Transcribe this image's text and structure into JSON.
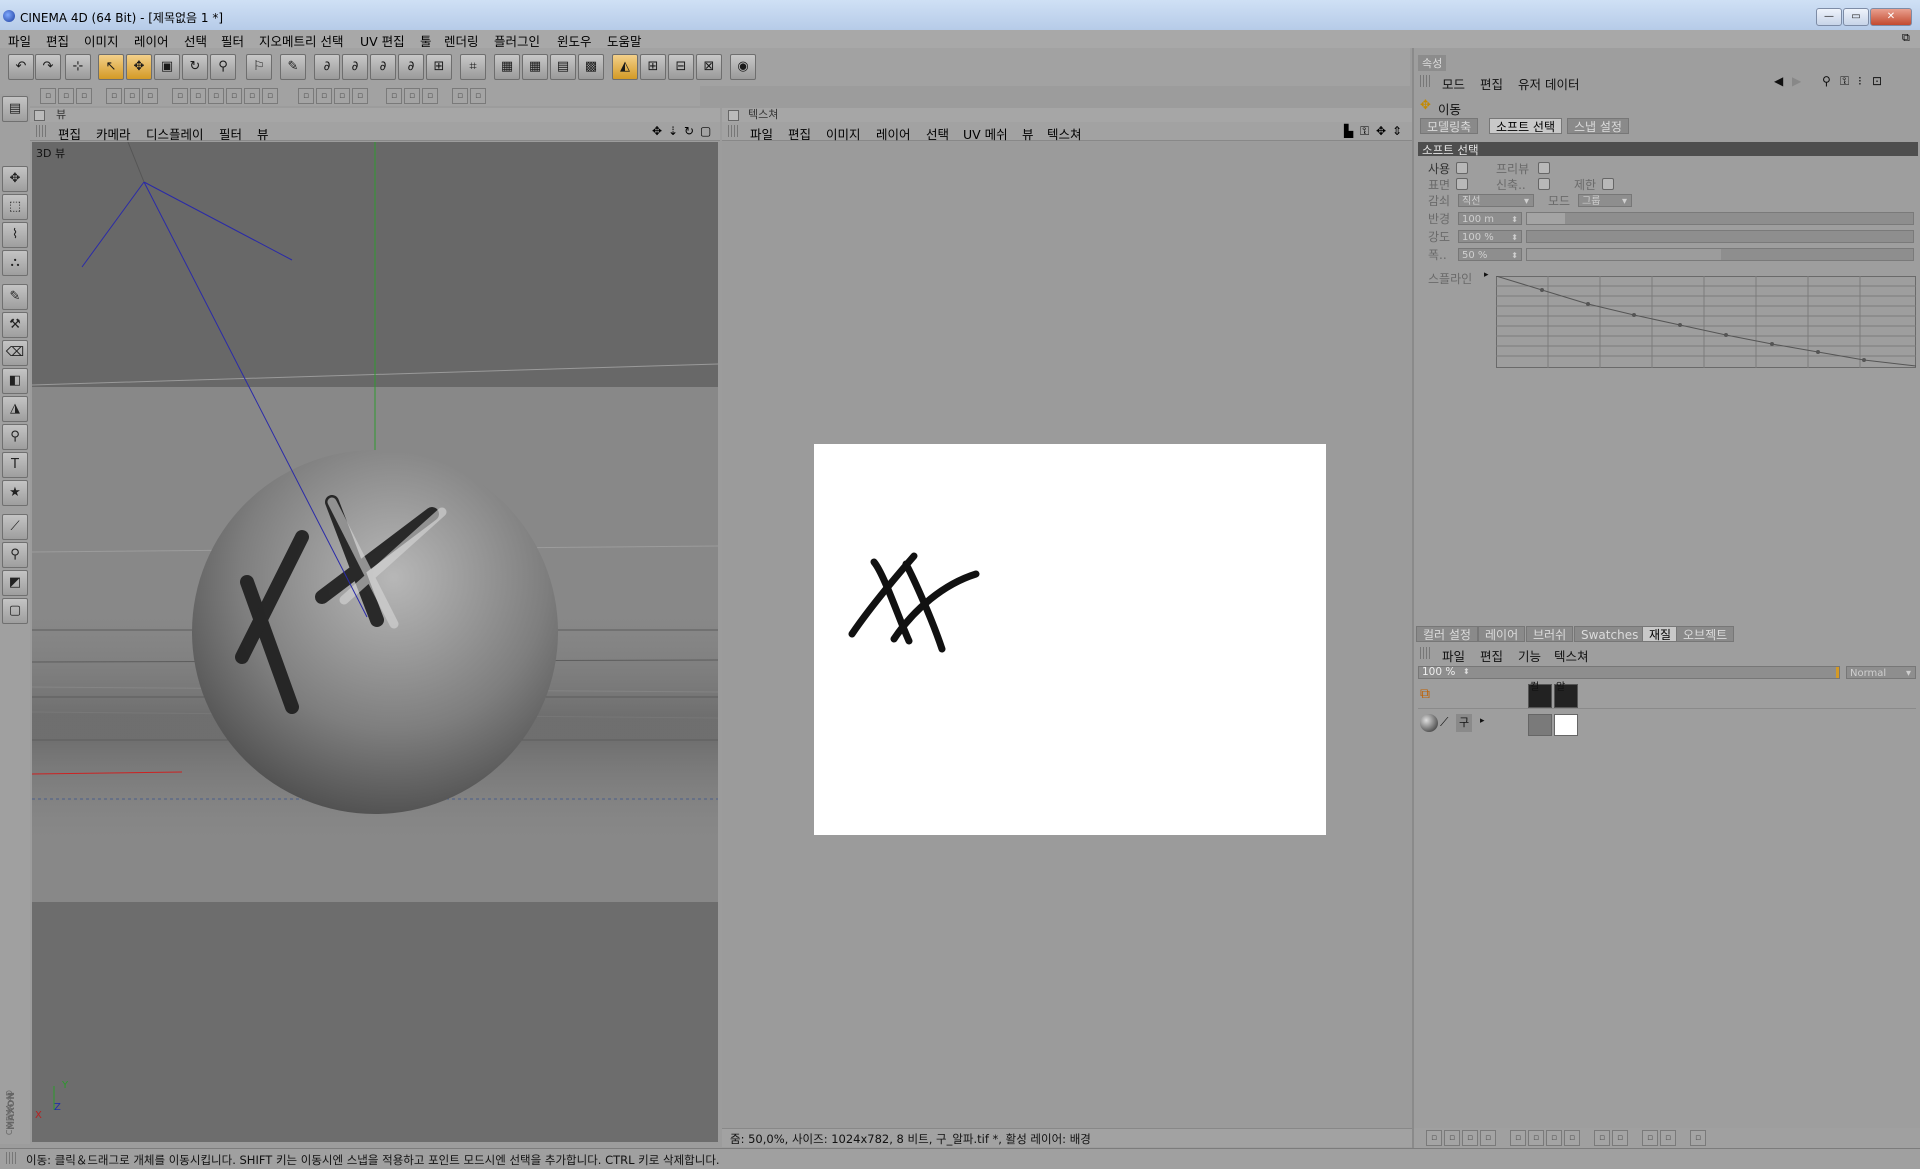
{
  "window": {
    "title": "CINEMA 4D (64 Bit) - [제목없음 1 *]"
  },
  "menubar": {
    "items": [
      "파일",
      "편집",
      "이미지",
      "레이어",
      "선택",
      "필터",
      "지오메트리 선택",
      "UV 편집",
      "툴",
      "렌더링",
      "플러그인",
      "윈도우",
      "도움말"
    ]
  },
  "viewport": {
    "header": "뷰",
    "menu": [
      "편집",
      "카메라",
      "디스플레이",
      "필터",
      "뷰"
    ],
    "label": "3D 뷰"
  },
  "texture": {
    "header": "텍스쳐",
    "menu": [
      "파일",
      "편집",
      "이미지",
      "레이어",
      "선택",
      "UV 메쉬",
      "뷰",
      "텍스쳐"
    ],
    "status": "줌: 50,0%, 사이즈: 1024x782, 8 비트, 구_알파.tif *, 활성 레이어: 배경"
  },
  "attributes": {
    "header": "속성",
    "menu": [
      "모드",
      "편집",
      "유저 데이터"
    ],
    "tool_name": "이동",
    "tabs": [
      "모델링축",
      "소프트 선택",
      "스냅 설정"
    ],
    "active_tab": "소프트 선택",
    "section": "소프트 선택",
    "use_label": "사용",
    "preview_label": "프리뷰",
    "surface_label": "표면",
    "rubber_label": "신축..",
    "restrict_label": "제한",
    "falloff_label": "감쇠",
    "falloff_value": "직선",
    "mode_label": "모드",
    "mode_value": "그룹",
    "radius_label": "반경",
    "radius_value": "100 m",
    "strength_label": "강도",
    "strength_value": "100 %",
    "width_label": "폭..",
    "width_value": "50 %",
    "spline_label": "스플라인"
  },
  "layers": {
    "tabs": [
      "컬러 설정",
      "레이어",
      "브러쉬",
      "Swatches",
      "재질",
      "오브젝트"
    ],
    "active_tab": "재질",
    "menu": [
      "파일",
      "편집",
      "기능",
      "텍스쳐"
    ],
    "opacity": "100 %",
    "blend": "Normal",
    "row1_labels": [
      "컬",
      "알"
    ],
    "row2_label": "구"
  },
  "statusbar": {
    "text": "이동: 클릭＆드래그로 개체를 이동시킵니다. SHIFT 키는 이동시엔 스냅을 적용하고 포인트 모드시엔 선택을 추가합니다. CTRL 키로 삭제합니다."
  },
  "brand": {
    "maxon": "MAXON",
    "cinema": "CINEMA 4D"
  }
}
